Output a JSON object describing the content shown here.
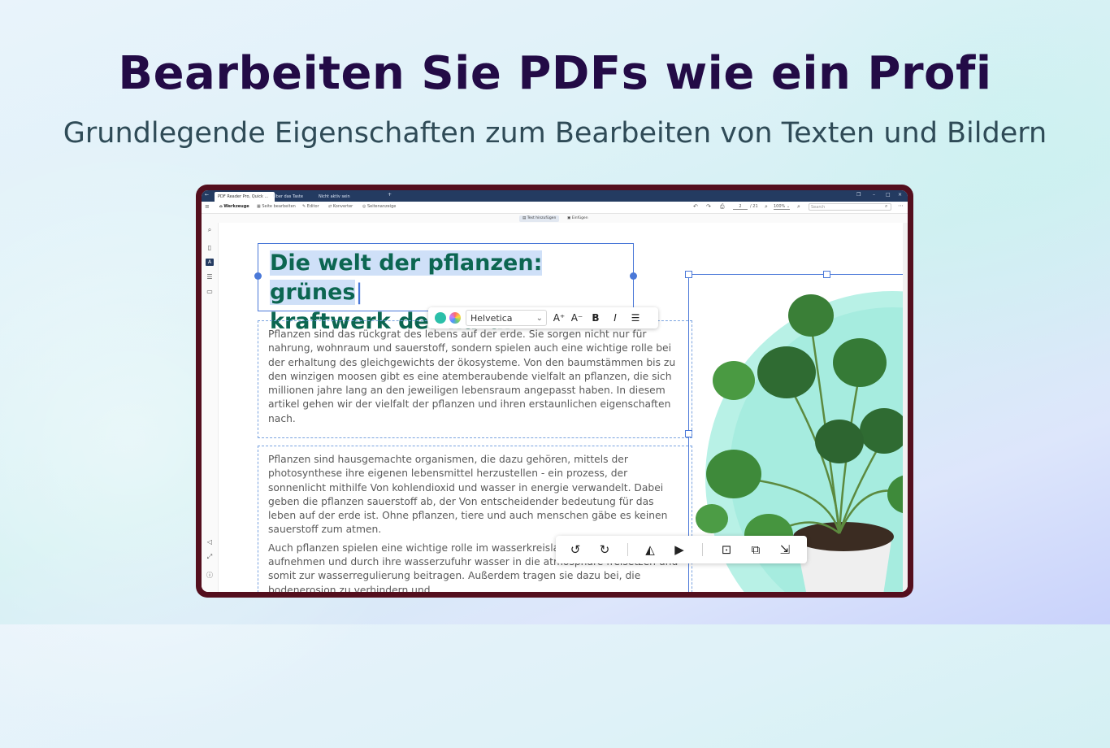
{
  "hero": {
    "title": "Bearbeiten Sie PDFs wie ein Profi",
    "subtitle": "Grundlegende Eigenschaften zum Bearbeiten von Texten und Bildern"
  },
  "app": {
    "tabs": [
      {
        "label": "PDF Reader Pro, Quick ..."
      },
      {
        "label": "Über das Taste"
      },
      {
        "label": "Nicht aktiv sein"
      }
    ],
    "new_tab_label": "+",
    "toolbar": {
      "items": [
        {
          "label": "Werkzeuge"
        },
        {
          "label": "Seite bearbeiten"
        },
        {
          "label": "Editor"
        },
        {
          "label": "Konverter"
        },
        {
          "label": "Seitenanzeige"
        }
      ],
      "page_current": "2",
      "page_total": "/ 21",
      "zoom": "100%",
      "search_placeholder": "Search"
    },
    "subtoolbar": {
      "items": [
        {
          "label": "Text hinzufügen"
        },
        {
          "label": "Einfügen"
        }
      ]
    }
  },
  "document": {
    "headline_line1": "Die welt der pflanzen: grünes",
    "headline_line2": "kraftwerk der natur",
    "paragraph1": "Pflanzen sind das rückgrat des lebens auf der erde. Sie sorgen nicht nur für nahrung, wohnraum und sauerstoff, sondern spielen auch eine wichtige rolle bei der erhaltung des gleichgewichts der ökosysteme. Von den baumstämmen bis zu den winzigen moosen gibt es eine atemberaubende vielfalt an pflanzen, die sich millionen jahre lang an den jeweiligen lebensraum angepasst haben. In diesem artikel gehen wir der vielfalt der pflanzen und ihren erstaunlichen eigenschaften nach.",
    "paragraph2": "Pflanzen sind hausgemachte organismen, die dazu gehören, mittels der photosynthese ihre eigenen lebensmittel herzustellen - ein prozess, der sonnenlicht mithilfe Von kohlendioxid und wasser in energie verwandelt. Dabei geben die pflanzen sauerstoff ab, der Von entscheidender bedeutung für das leben auf der erde ist. Ohne pflanzen, tiere und auch menschen gäbe es keinen sauerstoff zum atmen.",
    "paragraph3": "Auch pflanzen spielen eine wichtige rolle im wasserkreislauf, indem sie Regen aufnehmen und durch ihre wasserzufuhr wasser in die atmosphäre freisetzen und somit zur wasserregulierung beitragen. Außerdem tragen sie dazu bei, die bodenerosion zu verhindern und"
  },
  "format_bar": {
    "font": "Helvetica",
    "increase": "A⁺",
    "decrease": "A⁻",
    "bold": "B",
    "italic": "I",
    "colors": {
      "swatch": "#2bbfa9"
    }
  },
  "colors": {
    "hero_title": "#230b46",
    "headline": "#0c6651",
    "device_frame": "#540f1e",
    "titlebar": "#243b61",
    "selection": "#4a78d8"
  }
}
